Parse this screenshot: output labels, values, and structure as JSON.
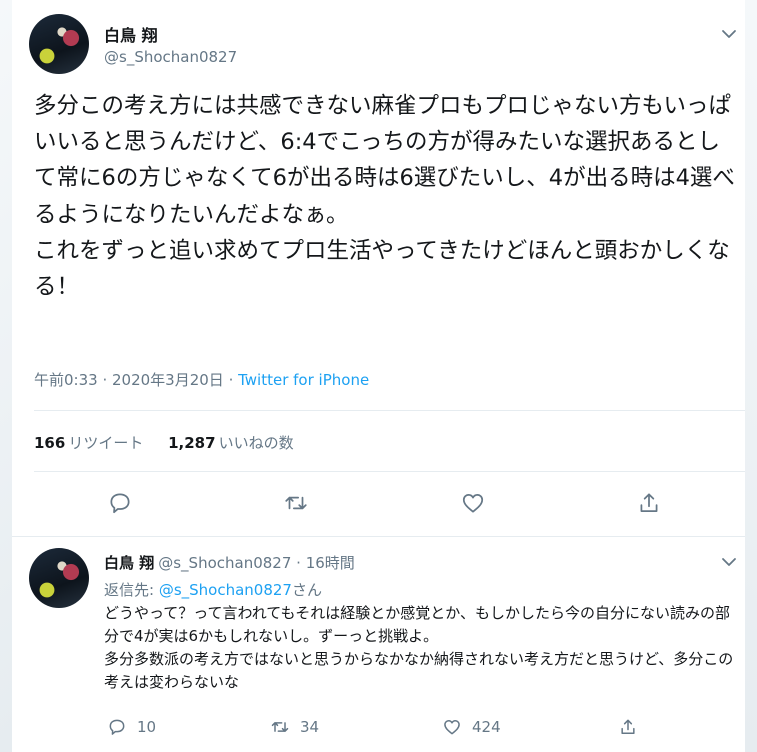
{
  "colors": {
    "accent": "#1da1f2",
    "muted": "#657786",
    "text": "#14171a",
    "divider": "#e6ecf0"
  },
  "tweet": {
    "author_name": "白鳥 翔",
    "handle": "@s_Shochan0827",
    "text": "多分この考え方には共感できない麻雀プロもプロじゃない方もいっぱいいると思うんだけど、6:4でこっちの方が得みたいな選択あるとして常に6の方じゃなくて6が出る時は6選びたいし、4が出る時は4選べるようになりたいんだよなぁ。\nこれをずっと追い求めてプロ生活やってきたけどほんと頭おかしくなる！",
    "timestamp": "午前0:33 · 2020年3月20日",
    "separator": " · ",
    "source": "Twitter for iPhone",
    "retweets_count": "166",
    "retweets_label": "リツイート",
    "likes_count": "1,287",
    "likes_label": "いいねの数",
    "icons": {
      "menu": "chevron-down-icon",
      "reply": "reply-icon",
      "retweet": "retweet-icon",
      "like": "heart-icon",
      "share": "share-icon"
    }
  },
  "reply": {
    "author_name": "白鳥 翔",
    "handle": "@s_Shochan0827",
    "dot": " · ",
    "time": "16時間",
    "replying_prefix": "返信先: ",
    "replying_mention": "@s_Shochan0827",
    "replying_suffix": "さん",
    "text": "どうやって？って言われてもそれは経験とか感覚とか、もしかしたら今の自分にない読みの部分で4が実は6かもしれないし。ずーっと挑戦よ。\n多分多数派の考え方ではないと思うからなかなか納得されない考え方だと思うけど、多分この考えは変わらないな",
    "reply_count": "10",
    "retweet_count": "34",
    "like_count": "424"
  }
}
